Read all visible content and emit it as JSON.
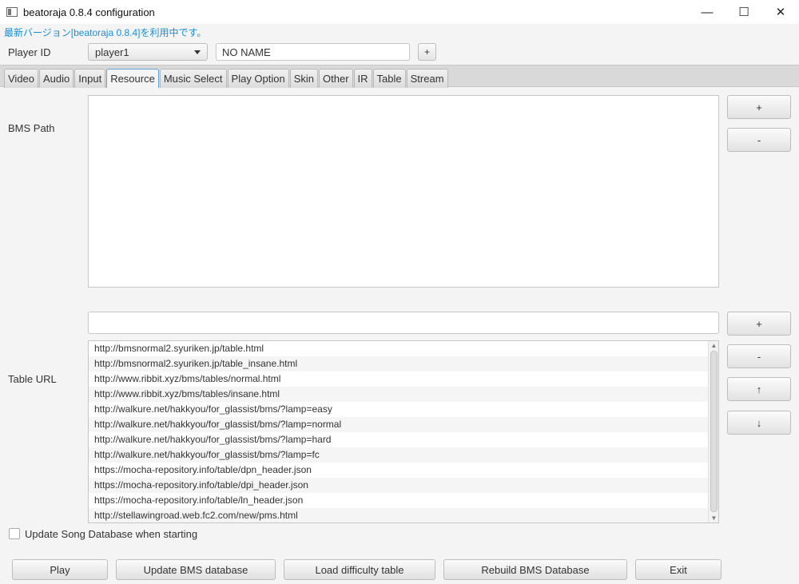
{
  "window": {
    "title": "beatoraja 0.8.4 configuration",
    "minimize": "—",
    "maximize": "☐",
    "close": "✕"
  },
  "version_notice": "最新バージョン[beatoraja 0.8.4]を利用中です。",
  "player": {
    "label": "Player ID",
    "selected": "player1",
    "name_value": "NO NAME",
    "add_label": "+"
  },
  "tabs": [
    {
      "label": "Video"
    },
    {
      "label": "Audio"
    },
    {
      "label": "Input"
    },
    {
      "label": "Resource",
      "selected": true
    },
    {
      "label": "Music Select"
    },
    {
      "label": "Play Option"
    },
    {
      "label": "Skin"
    },
    {
      "label": "Other"
    },
    {
      "label": "IR"
    },
    {
      "label": "Table"
    },
    {
      "label": "Stream"
    }
  ],
  "bms_path": {
    "label": "BMS Path",
    "add_label": "+",
    "remove_label": "-"
  },
  "table_url": {
    "label": "Table URL",
    "input_value": "",
    "add_label": "+",
    "remove_label": "-",
    "up_label": "↑",
    "down_label": "↓",
    "items": [
      "http://bmsnormal2.syuriken.jp/table.html",
      "http://bmsnormal2.syuriken.jp/table_insane.html",
      "http://www.ribbit.xyz/bms/tables/normal.html",
      "http://www.ribbit.xyz/bms/tables/insane.html",
      "http://walkure.net/hakkyou/for_glassist/bms/?lamp=easy",
      "http://walkure.net/hakkyou/for_glassist/bms/?lamp=normal",
      "http://walkure.net/hakkyou/for_glassist/bms/?lamp=hard",
      "http://walkure.net/hakkyou/for_glassist/bms/?lamp=fc",
      "https://mocha-repository.info/table/dpn_header.json",
      "https://mocha-repository.info/table/dpi_header.json",
      "https://mocha-repository.info/table/ln_header.json",
      "http://stellawingroad.web.fc2.com/new/pms.html"
    ]
  },
  "update_on_start": {
    "label": "Update Song Database when starting",
    "checked": false
  },
  "buttons": {
    "play": "Play",
    "update_db": "Update BMS database",
    "load_table": "Load difficulty table",
    "rebuild_db": "Rebuild BMS Database",
    "exit": "Exit"
  }
}
